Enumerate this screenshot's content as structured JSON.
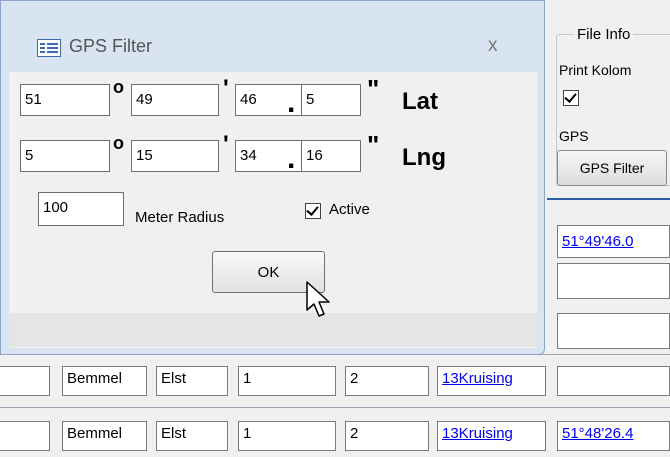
{
  "dialog": {
    "title": "GPS Filter",
    "close_glyph": "x",
    "lat": {
      "deg": "51",
      "min": "49",
      "sec": "46",
      "frac": "5",
      "label": "Lat"
    },
    "lng": {
      "deg": "5",
      "min": "15",
      "sec": "34",
      "frac": "16",
      "label": "Lng"
    },
    "symbols": {
      "degree": "o",
      "minute": "'",
      "dot": ".",
      "second": "\""
    },
    "radius": {
      "value": "100",
      "label": "Meter Radius"
    },
    "active": {
      "label": "Active",
      "checked": true
    },
    "ok_label": "OK"
  },
  "side": {
    "legend": "File Info",
    "print_label": "Print Kolom",
    "gps_label": "GPS",
    "gps_filter_button": "GPS Filter",
    "link1": "51°49'46.0",
    "link2": "51°48'26.4"
  },
  "rows": [
    {
      "c1": "Bemmel",
      "c2": "Elst",
      "c3": "1",
      "c4": "2",
      "link": "13Kruising"
    },
    {
      "c1": "Bemmel",
      "c2": "Elst",
      "c3": "1",
      "c4": "2",
      "link": "13Kruising"
    }
  ]
}
